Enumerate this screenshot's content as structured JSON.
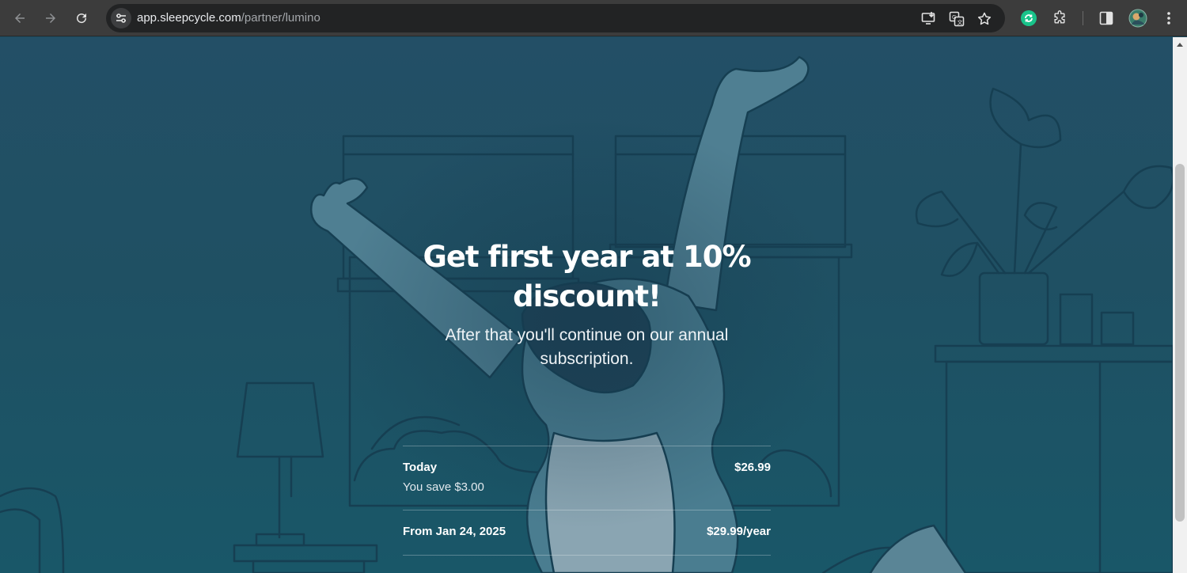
{
  "browser": {
    "url_host": "app.sleepcycle.com",
    "url_path": "/partner/lumino",
    "icons": [
      "back-arrow-icon",
      "forward-arrow-icon",
      "reload-icon",
      "site-settings-icon",
      "install-app-icon",
      "translate-icon",
      "bookmark-star-icon",
      "extension-green-icon",
      "extensions-puzzle-icon",
      "side-panel-icon",
      "profile-avatar-icon",
      "more-menu-icon"
    ]
  },
  "offer": {
    "title": "Get first year at 10% discount!",
    "subtitle": "After that you'll continue on our annual subscription."
  },
  "pricing": {
    "today_label": "Today",
    "today_price": "$26.99",
    "savings_note": "You save $3.00",
    "renewal_label": "From Jan 24, 2025",
    "renewal_price": "$29.99/year"
  },
  "colors": {
    "background": "#1f5063",
    "text": "#ffffff",
    "chrome": "#3c3c3c"
  }
}
